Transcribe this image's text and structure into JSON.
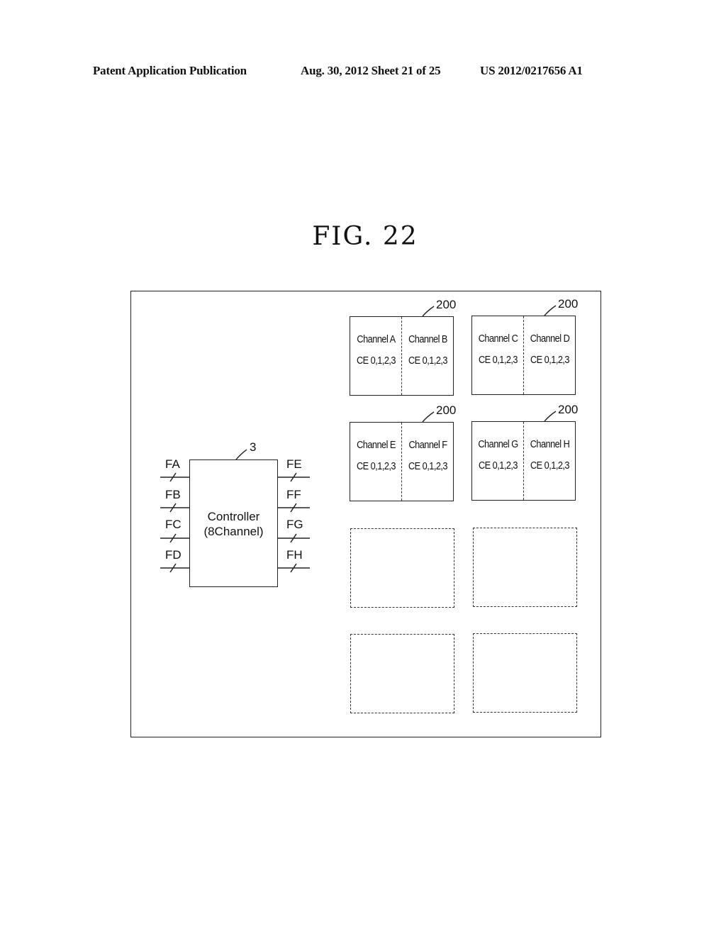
{
  "header": {
    "publication": "Patent Application Publication",
    "date_sheet": "Aug. 30, 2012  Sheet 21 of 25",
    "patent_number": "US 2012/0217656 A1"
  },
  "figure": {
    "title": "FIG. 22"
  },
  "controller": {
    "ref": "3",
    "line1": "Controller",
    "line2": "(8Channel)",
    "left_signals": [
      "FA",
      "FB",
      "FC",
      "FD"
    ],
    "right_signals": [
      "FE",
      "FF",
      "FG",
      "FH"
    ]
  },
  "packages": [
    {
      "ref": "200",
      "left": {
        "channel": "Channel A",
        "ce": "CE 0,1,2,3"
      },
      "right": {
        "channel": "Channel B",
        "ce": "CE 0,1,2,3"
      }
    },
    {
      "ref": "200",
      "left": {
        "channel": "Channel C",
        "ce": "CE 0,1,2,3"
      },
      "right": {
        "channel": "Channel D",
        "ce": "CE 0,1,2,3"
      }
    },
    {
      "ref": "200",
      "left": {
        "channel": "Channel E",
        "ce": "CE 0,1,2,3"
      },
      "right": {
        "channel": "Channel F",
        "ce": "CE 0,1,2,3"
      }
    },
    {
      "ref": "200",
      "left": {
        "channel": "Channel G",
        "ce": "CE 0,1,2,3"
      },
      "right": {
        "channel": "Channel H",
        "ce": "CE 0,1,2,3"
      }
    }
  ],
  "empty_slots": 4
}
